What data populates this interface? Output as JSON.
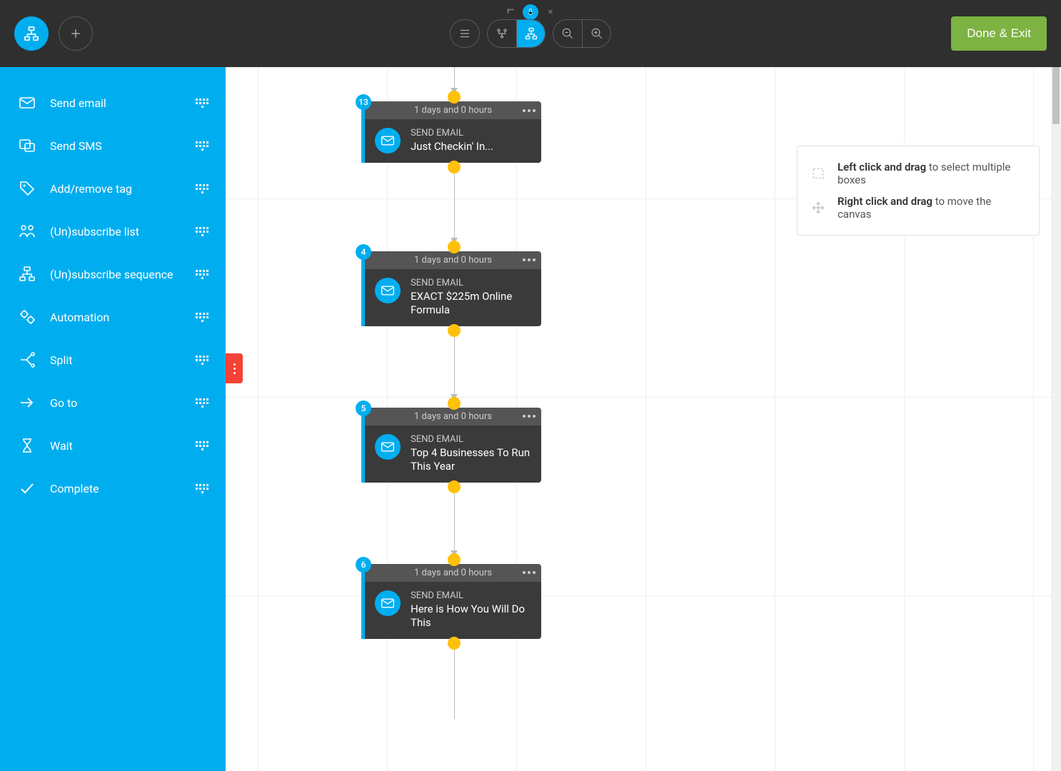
{
  "topbar": {
    "done_label": "Done & Exit"
  },
  "sidebar": {
    "items": [
      {
        "label": "Send email",
        "icon": "email"
      },
      {
        "label": "Send SMS",
        "icon": "sms"
      },
      {
        "label": "Add/remove tag",
        "icon": "tag"
      },
      {
        "label": "(Un)subscribe list",
        "icon": "people"
      },
      {
        "label": "(Un)subscribe sequence",
        "icon": "sequence"
      },
      {
        "label": "Automation",
        "icon": "gears"
      },
      {
        "label": "Split",
        "icon": "split"
      },
      {
        "label": "Go to",
        "icon": "arrow-right"
      },
      {
        "label": "Wait",
        "icon": "hourglass"
      },
      {
        "label": "Complete",
        "icon": "check"
      }
    ]
  },
  "help": {
    "line1_bold": "Left click and drag",
    "line1_rest": " to select multiple boxes",
    "line2_bold": "Right click and drag",
    "line2_rest": " to move the canvas"
  },
  "nodes": [
    {
      "badge": "13",
      "delay": "1 days and 0 hours",
      "type": "SEND EMAIL",
      "title": "Just Checkin' In..."
    },
    {
      "badge": "4",
      "delay": "1 days and 0 hours",
      "type": "SEND EMAIL",
      "title": "EXACT $225m Online Formula"
    },
    {
      "badge": "5",
      "delay": "1 days and 0 hours",
      "type": "SEND EMAIL",
      "title": "Top 4 Businesses To Run This Year"
    },
    {
      "badge": "6",
      "delay": "1 days and 0 hours",
      "type": "SEND EMAIL",
      "title": "Here is How You Will Do This"
    }
  ]
}
